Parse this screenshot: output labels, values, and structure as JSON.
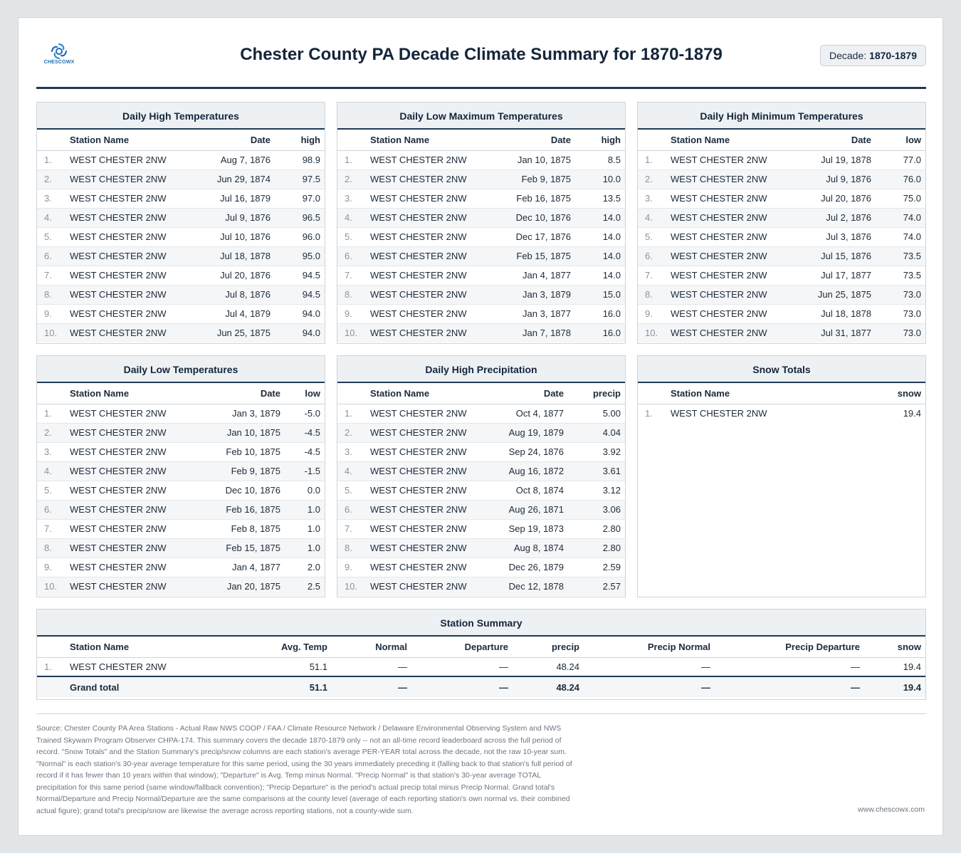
{
  "header": {
    "logo_text": "CHESCOWX",
    "title": "Chester County PA Decade Climate Summary for 1870-1879",
    "decade_label": "Decade:",
    "decade_value": "1870-1879"
  },
  "tables": {
    "high_temps": {
      "title": "Daily High Temperatures",
      "columns": [
        "Station Name",
        "Date",
        "high"
      ],
      "rows": [
        {
          "rank": "1.",
          "station": "WEST CHESTER 2NW",
          "date": "Aug 7, 1876",
          "value": "98.9"
        },
        {
          "rank": "2.",
          "station": "WEST CHESTER 2NW",
          "date": "Jun 29, 1874",
          "value": "97.5"
        },
        {
          "rank": "3.",
          "station": "WEST CHESTER 2NW",
          "date": "Jul 16, 1879",
          "value": "97.0"
        },
        {
          "rank": "4.",
          "station": "WEST CHESTER 2NW",
          "date": "Jul 9, 1876",
          "value": "96.5"
        },
        {
          "rank": "5.",
          "station": "WEST CHESTER 2NW",
          "date": "Jul 10, 1876",
          "value": "96.0"
        },
        {
          "rank": "6.",
          "station": "WEST CHESTER 2NW",
          "date": "Jul 18, 1878",
          "value": "95.0"
        },
        {
          "rank": "7.",
          "station": "WEST CHESTER 2NW",
          "date": "Jul 20, 1876",
          "value": "94.5"
        },
        {
          "rank": "8.",
          "station": "WEST CHESTER 2NW",
          "date": "Jul 8, 1876",
          "value": "94.5"
        },
        {
          "rank": "9.",
          "station": "WEST CHESTER 2NW",
          "date": "Jul 4, 1879",
          "value": "94.0"
        },
        {
          "rank": "10.",
          "station": "WEST CHESTER 2NW",
          "date": "Jun 25, 1875",
          "value": "94.0"
        }
      ]
    },
    "low_max_temps": {
      "title": "Daily Low Maximum Temperatures",
      "columns": [
        "Station Name",
        "Date",
        "high"
      ],
      "rows": [
        {
          "rank": "1.",
          "station": "WEST CHESTER 2NW",
          "date": "Jan 10, 1875",
          "value": "8.5"
        },
        {
          "rank": "2.",
          "station": "WEST CHESTER 2NW",
          "date": "Feb 9, 1875",
          "value": "10.0"
        },
        {
          "rank": "3.",
          "station": "WEST CHESTER 2NW",
          "date": "Feb 16, 1875",
          "value": "13.5"
        },
        {
          "rank": "4.",
          "station": "WEST CHESTER 2NW",
          "date": "Dec 10, 1876",
          "value": "14.0"
        },
        {
          "rank": "5.",
          "station": "WEST CHESTER 2NW",
          "date": "Dec 17, 1876",
          "value": "14.0"
        },
        {
          "rank": "6.",
          "station": "WEST CHESTER 2NW",
          "date": "Feb 15, 1875",
          "value": "14.0"
        },
        {
          "rank": "7.",
          "station": "WEST CHESTER 2NW",
          "date": "Jan 4, 1877",
          "value": "14.0"
        },
        {
          "rank": "8.",
          "station": "WEST CHESTER 2NW",
          "date": "Jan 3, 1879",
          "value": "15.0"
        },
        {
          "rank": "9.",
          "station": "WEST CHESTER 2NW",
          "date": "Jan 3, 1877",
          "value": "16.0"
        },
        {
          "rank": "10.",
          "station": "WEST CHESTER 2NW",
          "date": "Jan 7, 1878",
          "value": "16.0"
        }
      ]
    },
    "high_min_temps": {
      "title": "Daily High Minimum Temperatures",
      "columns": [
        "Station Name",
        "Date",
        "low"
      ],
      "rows": [
        {
          "rank": "1.",
          "station": "WEST CHESTER 2NW",
          "date": "Jul 19, 1878",
          "value": "77.0"
        },
        {
          "rank": "2.",
          "station": "WEST CHESTER 2NW",
          "date": "Jul 9, 1876",
          "value": "76.0"
        },
        {
          "rank": "3.",
          "station": "WEST CHESTER 2NW",
          "date": "Jul 20, 1876",
          "value": "75.0"
        },
        {
          "rank": "4.",
          "station": "WEST CHESTER 2NW",
          "date": "Jul 2, 1876",
          "value": "74.0"
        },
        {
          "rank": "5.",
          "station": "WEST CHESTER 2NW",
          "date": "Jul 3, 1876",
          "value": "74.0"
        },
        {
          "rank": "6.",
          "station": "WEST CHESTER 2NW",
          "date": "Jul 15, 1876",
          "value": "73.5"
        },
        {
          "rank": "7.",
          "station": "WEST CHESTER 2NW",
          "date": "Jul 17, 1877",
          "value": "73.5"
        },
        {
          "rank": "8.",
          "station": "WEST CHESTER 2NW",
          "date": "Jun 25, 1875",
          "value": "73.0"
        },
        {
          "rank": "9.",
          "station": "WEST CHESTER 2NW",
          "date": "Jul 18, 1878",
          "value": "73.0"
        },
        {
          "rank": "10.",
          "station": "WEST CHESTER 2NW",
          "date": "Jul 31, 1877",
          "value": "73.0"
        }
      ]
    },
    "low_temps": {
      "title": "Daily Low Temperatures",
      "columns": [
        "Station Name",
        "Date",
        "low"
      ],
      "rows": [
        {
          "rank": "1.",
          "station": "WEST CHESTER 2NW",
          "date": "Jan 3, 1879",
          "value": "-5.0"
        },
        {
          "rank": "2.",
          "station": "WEST CHESTER 2NW",
          "date": "Jan 10, 1875",
          "value": "-4.5"
        },
        {
          "rank": "3.",
          "station": "WEST CHESTER 2NW",
          "date": "Feb 10, 1875",
          "value": "-4.5"
        },
        {
          "rank": "4.",
          "station": "WEST CHESTER 2NW",
          "date": "Feb 9, 1875",
          "value": "-1.5"
        },
        {
          "rank": "5.",
          "station": "WEST CHESTER 2NW",
          "date": "Dec 10, 1876",
          "value": "0.0"
        },
        {
          "rank": "6.",
          "station": "WEST CHESTER 2NW",
          "date": "Feb 16, 1875",
          "value": "1.0"
        },
        {
          "rank": "7.",
          "station": "WEST CHESTER 2NW",
          "date": "Feb 8, 1875",
          "value": "1.0"
        },
        {
          "rank": "8.",
          "station": "WEST CHESTER 2NW",
          "date": "Feb 15, 1875",
          "value": "1.0"
        },
        {
          "rank": "9.",
          "station": "WEST CHESTER 2NW",
          "date": "Jan 4, 1877",
          "value": "2.0"
        },
        {
          "rank": "10.",
          "station": "WEST CHESTER 2NW",
          "date": "Jan 20, 1875",
          "value": "2.5"
        }
      ]
    },
    "high_precip": {
      "title": "Daily High Precipitation",
      "columns": [
        "Station Name",
        "Date",
        "precip"
      ],
      "rows": [
        {
          "rank": "1.",
          "station": "WEST CHESTER 2NW",
          "date": "Oct 4, 1877",
          "value": "5.00"
        },
        {
          "rank": "2.",
          "station": "WEST CHESTER 2NW",
          "date": "Aug 19, 1879",
          "value": "4.04"
        },
        {
          "rank": "3.",
          "station": "WEST CHESTER 2NW",
          "date": "Sep 24, 1876",
          "value": "3.92"
        },
        {
          "rank": "4.",
          "station": "WEST CHESTER 2NW",
          "date": "Aug 16, 1872",
          "value": "3.61"
        },
        {
          "rank": "5.",
          "station": "WEST CHESTER 2NW",
          "date": "Oct 8, 1874",
          "value": "3.12"
        },
        {
          "rank": "6.",
          "station": "WEST CHESTER 2NW",
          "date": "Aug 26, 1871",
          "value": "3.06"
        },
        {
          "rank": "7.",
          "station": "WEST CHESTER 2NW",
          "date": "Sep 19, 1873",
          "value": "2.80"
        },
        {
          "rank": "8.",
          "station": "WEST CHESTER 2NW",
          "date": "Aug 8, 1874",
          "value": "2.80"
        },
        {
          "rank": "9.",
          "station": "WEST CHESTER 2NW",
          "date": "Dec 26, 1879",
          "value": "2.59"
        },
        {
          "rank": "10.",
          "station": "WEST CHESTER 2NW",
          "date": "Dec 12, 1878",
          "value": "2.57"
        }
      ]
    },
    "snow_totals": {
      "title": "Snow Totals",
      "columns": [
        "Station Name",
        "snow"
      ],
      "rows": [
        {
          "rank": "1.",
          "station": "WEST CHESTER 2NW",
          "value": "19.4"
        }
      ]
    }
  },
  "summary": {
    "title": "Station Summary",
    "columns": [
      "Station Name",
      "Avg. Temp",
      "Normal",
      "Departure",
      "precip",
      "Precip Normal",
      "Precip Departure",
      "snow"
    ],
    "rows": [
      {
        "rank": "1.",
        "station": "WEST CHESTER 2NW",
        "avg_temp": "51.1",
        "normal": "—",
        "departure": "—",
        "precip": "48.24",
        "precip_normal": "—",
        "precip_departure": "—",
        "snow": "19.4"
      }
    ],
    "total": {
      "label": "Grand total",
      "avg_temp": "51.1",
      "normal": "—",
      "departure": "—",
      "precip": "48.24",
      "precip_normal": "—",
      "precip_departure": "—",
      "snow": "19.4"
    }
  },
  "footer": {
    "source": "Source: Chester County PA Area Stations - Actual Raw NWS COOP / FAA / Climate Resource Network / Delaware Environmental Observing System and NWS Trained Skywarn Program Observer CHPA-174. This summary covers the decade 1870-1879 only -- not an all-time record leaderboard across the full period of record. \"Snow Totals\" and the Station Summary's precip/snow columns are each station's average PER-YEAR total across the decade, not the raw 10-year sum. \"Normal\" is each station's 30-year average temperature for this same period, using the 30 years immediately preceding it (falling back to that station's full period of record if it has fewer than 10 years within that window); \"Departure\" is Avg. Temp minus Normal. \"Precip Normal\" is that station's 30-year average TOTAL precipitation for this same period (same window/fallback convention); \"Precip Departure\" is the period's actual precip total minus Precip Normal. Grand total's Normal/Departure and Precip Normal/Departure are the same comparisons at the county level (average of each reporting station's own normal vs. their combined actual figure); grand total's precip/snow are likewise the average across reporting stations, not a county-wide sum.",
    "site": "www.chescowx.com"
  }
}
